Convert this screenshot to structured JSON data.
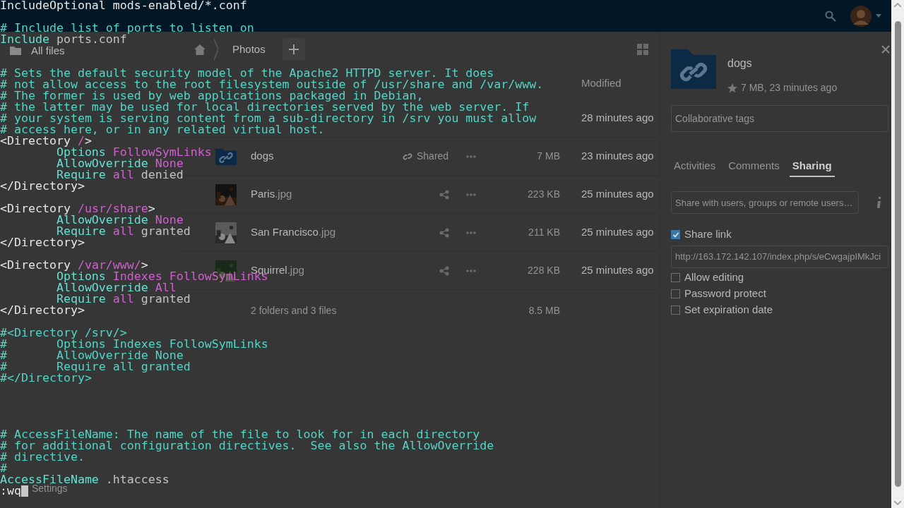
{
  "sidebar": {
    "items": [
      {
        "label": "All files"
      }
    ],
    "footer_item": "Settings"
  },
  "breadcrumb": [
    "Photos"
  ],
  "file_list": {
    "columns": [
      "Modified"
    ],
    "rows": [
      {
        "modified": "28 minutes ago"
      },
      {
        "kind": "shared_folder",
        "name": "dogs",
        "share": "Shared",
        "size": "7 MB",
        "modified": "23 minutes ago"
      },
      {
        "name": "Paris",
        "extension": ".jpg",
        "size": "223 KB",
        "modified": "25 minutes ago"
      },
      {
        "name": "San Francisco",
        "extension": ".jpg",
        "size": "211 KB",
        "modified": "25 minutes ago"
      },
      {
        "name": "Squirrel",
        "extension": ".jpg",
        "size": "228 KB",
        "modified": "25 minutes ago"
      }
    ],
    "summary": "2 folders and 3 files",
    "total_size": "8.5 MB"
  },
  "details": {
    "name": "dogs",
    "meta": "7 MB, 23 minutes ago",
    "tags_placeholder": "Collaborative tags",
    "tabs": [
      {
        "label": "Activities",
        "selected": false
      },
      {
        "label": "Comments",
        "selected": false
      },
      {
        "label": "Sharing",
        "selected": true
      }
    ],
    "share_placeholder": "Share with users, groups or remote users…",
    "share_link": {
      "label": "Share link",
      "checked": true,
      "url": "http://163.172.142.107/index.php/s/eCwgajpIMkJci"
    },
    "options": [
      {
        "label": "Allow editing",
        "checked": false
      },
      {
        "label": "Password protect",
        "checked": false
      },
      {
        "label": "Set expiration date",
        "checked": false
      }
    ]
  },
  "terminal": {
    "lines": [
      {
        "segments": [
          {
            "text": "IncludeOptional mods-enabled/*.conf",
            "kind": "directive"
          }
        ]
      },
      {
        "kind": "blank"
      },
      {
        "segments": [
          {
            "text": "# Include list of ports to listen on",
            "kind": "comment"
          }
        ]
      },
      {
        "segments": [
          {
            "text": "Include",
            "kind": "keyword"
          },
          {
            "text": " ports.conf",
            "kind": "plain"
          }
        ]
      },
      {
        "kind": "blank"
      },
      {
        "kind": "blank"
      },
      {
        "segments": [
          {
            "text": "# Sets the default security model of the Apache2 HTTPD server. It does",
            "kind": "comment"
          }
        ]
      },
      {
        "segments": [
          {
            "text": "# not allow access to the root filesystem outside of /usr/share and /var/www.",
            "kind": "comment"
          }
        ]
      },
      {
        "segments": [
          {
            "text": "# The former is used by web applications packaged in Debian,",
            "kind": "comment"
          }
        ]
      },
      {
        "segments": [
          {
            "text": "# the latter may be used for local directories served by the web server. If",
            "kind": "comment"
          }
        ]
      },
      {
        "segments": [
          {
            "text": "# your system is serving content from a sub-directory in /srv you must allow",
            "kind": "comment"
          }
        ]
      },
      {
        "segments": [
          {
            "text": "# access here, or in any related virtual host.",
            "kind": "comment"
          }
        ]
      },
      {
        "segments": [
          {
            "text": "<Directory ",
            "kind": "tag"
          },
          {
            "text": "/",
            "kind": "special"
          },
          {
            "text": ">",
            "kind": "tag"
          }
        ]
      },
      {
        "segments": [
          {
            "text": "        Options ",
            "kind": "keyword"
          },
          {
            "text": "FollowSymLinks",
            "kind": "special"
          }
        ]
      },
      {
        "segments": [
          {
            "text": "        AllowOverride ",
            "kind": "keyword"
          },
          {
            "text": "None",
            "kind": "special"
          }
        ]
      },
      {
        "segments": [
          {
            "text": "        Require ",
            "kind": "keyword"
          },
          {
            "text": "all",
            "kind": "special"
          },
          {
            "text": " denied",
            "kind": "plain"
          }
        ]
      },
      {
        "segments": [
          {
            "text": "</Directory>",
            "kind": "tag"
          }
        ]
      },
      {
        "kind": "blank"
      },
      {
        "segments": [
          {
            "text": "<Directory ",
            "kind": "tag"
          },
          {
            "text": "/usr/share",
            "kind": "special"
          },
          {
            "text": ">",
            "kind": "tag"
          }
        ]
      },
      {
        "segments": [
          {
            "text": "        AllowOverride ",
            "kind": "keyword"
          },
          {
            "text": "None",
            "kind": "special"
          }
        ]
      },
      {
        "segments": [
          {
            "text": "        Require ",
            "kind": "keyword"
          },
          {
            "text": "all",
            "kind": "special"
          },
          {
            "text": " granted",
            "kind": "plain"
          }
        ]
      },
      {
        "segments": [
          {
            "text": "</Directory>",
            "kind": "tag"
          }
        ]
      },
      {
        "kind": "blank"
      },
      {
        "segments": [
          {
            "text": "<Directory ",
            "kind": "tag"
          },
          {
            "text": "/var/www/",
            "kind": "special"
          },
          {
            "text": ">",
            "kind": "tag"
          }
        ]
      },
      {
        "segments": [
          {
            "text": "        Options ",
            "kind": "keyword"
          },
          {
            "text": "Indexes FollowSymLinks",
            "kind": "special"
          }
        ]
      },
      {
        "segments": [
          {
            "text": "        AllowOverride ",
            "kind": "keyword"
          },
          {
            "text": "All",
            "kind": "special"
          }
        ]
      },
      {
        "segments": [
          {
            "text": "        Require ",
            "kind": "keyword"
          },
          {
            "text": "all",
            "kind": "special"
          },
          {
            "text": " granted",
            "kind": "plain"
          }
        ]
      },
      {
        "segments": [
          {
            "text": "</Directory>",
            "kind": "tag"
          }
        ]
      },
      {
        "kind": "blank"
      },
      {
        "segments": [
          {
            "text": "#<Directory /srv/>",
            "kind": "comment"
          }
        ]
      },
      {
        "segments": [
          {
            "text": "#       Options Indexes FollowSymLinks",
            "kind": "comment"
          }
        ]
      },
      {
        "segments": [
          {
            "text": "#       AllowOverride None",
            "kind": "comment"
          }
        ]
      },
      {
        "segments": [
          {
            "text": "#       Require all granted",
            "kind": "comment"
          }
        ]
      },
      {
        "segments": [
          {
            "text": "#</Directory>",
            "kind": "comment"
          }
        ]
      },
      {
        "kind": "blank"
      },
      {
        "kind": "blank"
      },
      {
        "kind": "blank"
      },
      {
        "kind": "blank"
      },
      {
        "segments": [
          {
            "text": "# AccessFileName: The name of the file to look for in each directory",
            "kind": "comment"
          }
        ]
      },
      {
        "segments": [
          {
            "text": "# for additional configuration directives.  See also the AllowOverride",
            "kind": "comment"
          }
        ]
      },
      {
        "segments": [
          {
            "text": "# directive.",
            "kind": "comment"
          }
        ]
      },
      {
        "segments": [
          {
            "text": "#",
            "kind": "comment"
          }
        ]
      },
      {
        "segments": [
          {
            "text": "AccessFileName",
            "kind": "keyword"
          },
          {
            "text": " .htaccess",
            "kind": "plain"
          }
        ]
      },
      {
        "kind": "command",
        "segments": [
          {
            "text": ":wq",
            "kind": "directive"
          }
        ]
      }
    ]
  }
}
